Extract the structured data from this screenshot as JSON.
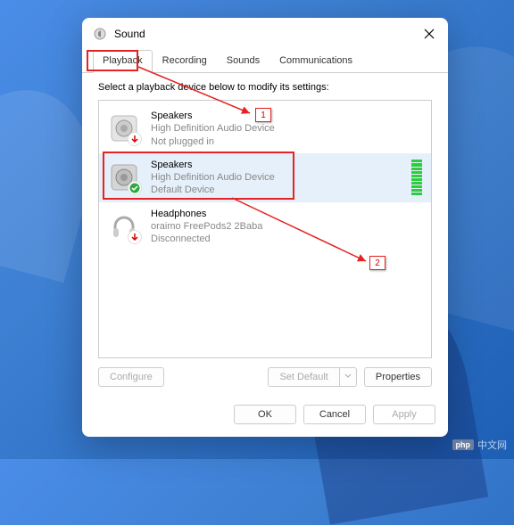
{
  "dialog": {
    "title": "Sound",
    "tabs": [
      "Playback",
      "Recording",
      "Sounds",
      "Communications"
    ],
    "active_tab_index": 0,
    "instruction": "Select a playback device below to modify its settings:",
    "devices": [
      {
        "title": "Speakers",
        "subtitle": "High Definition Audio Device",
        "status": "Not plugged in",
        "badge": "unplugged",
        "meter": false
      },
      {
        "title": "Speakers",
        "subtitle": "High Definition Audio Device",
        "status": "Default Device",
        "badge": "default",
        "meter": true,
        "selected": true
      },
      {
        "title": "Headphones",
        "subtitle": "oraimo FreePods2 2Baba",
        "status": "Disconnected",
        "badge": "unplugged",
        "meter": false
      }
    ],
    "buttons": {
      "configure": "Configure",
      "set_default": "Set Default",
      "properties": "Properties",
      "ok": "OK",
      "cancel": "Cancel",
      "apply": "Apply"
    }
  },
  "annotations": {
    "step1": "1",
    "step2": "2"
  },
  "watermark": {
    "badge": "php",
    "text": "中文网"
  }
}
